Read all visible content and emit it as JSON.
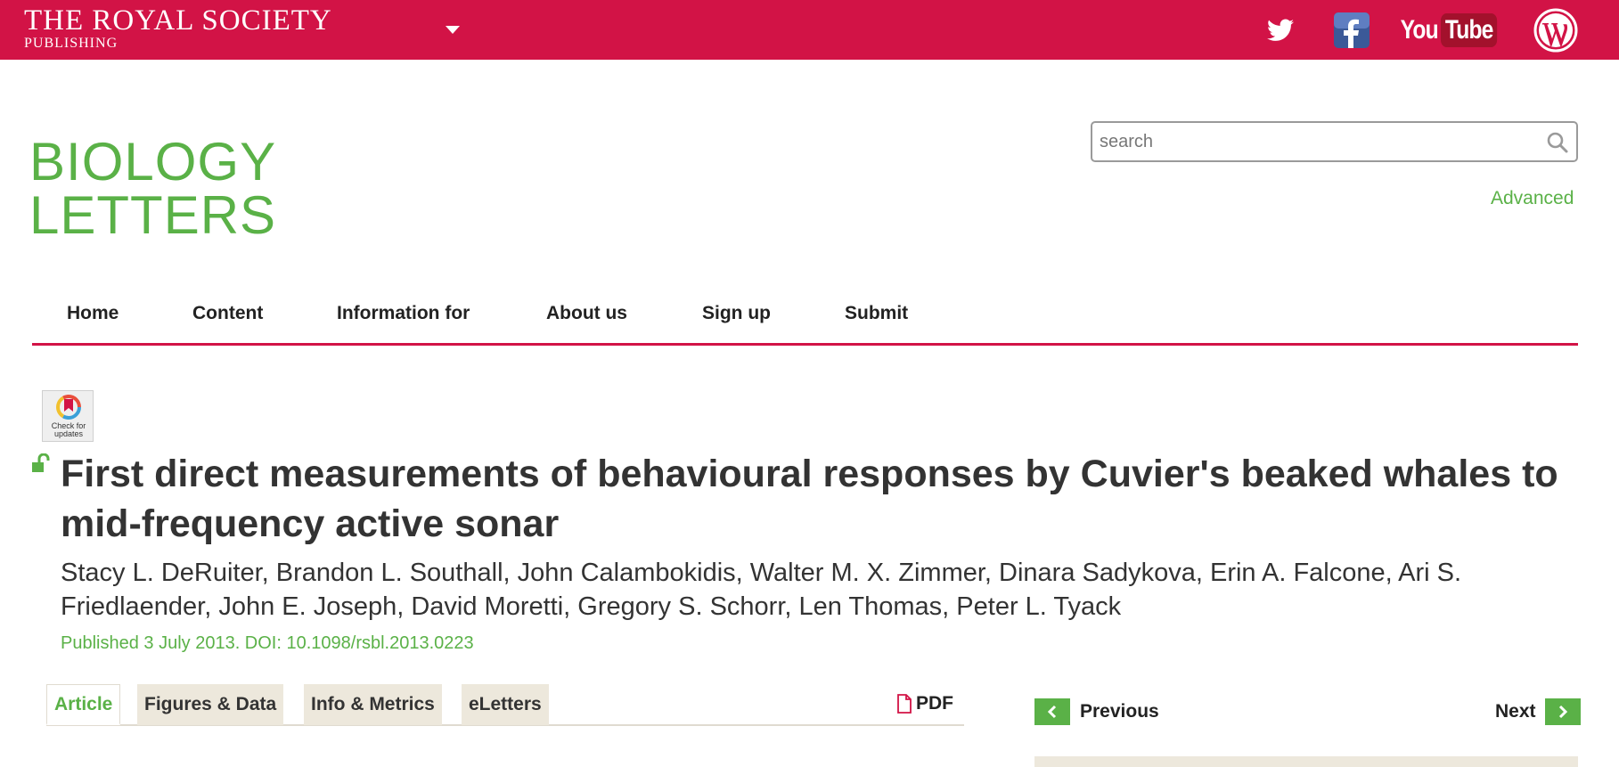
{
  "brand": {
    "name": "THE ROYAL SOCIETY",
    "sub": "PUBLISHING"
  },
  "social": {
    "youtube_you": "You",
    "youtube_tube": "Tube"
  },
  "journal": {
    "line1": "BIOLOGY",
    "line2": "LETTERS"
  },
  "search": {
    "placeholder": "search",
    "advanced_label": "Advanced"
  },
  "nav": {
    "items": [
      "Home",
      "Content",
      "Information for",
      "About us",
      "Sign up",
      "Submit"
    ]
  },
  "crossmark": {
    "label_line1": "Check for",
    "label_line2": "updates"
  },
  "article": {
    "title": "First direct measurements of behavioural responses by Cuvier's beaked whales to mid-frequency active sonar",
    "authors": "Stacy L. DeRuiter, Brandon L. Southall, John Calambokidis, Walter M. X. Zimmer, Dinara Sadykova, Erin A. Falcone, Ari S. Friedlaender, John E. Joseph, David Moretti, Gregory S. Schorr, Len Thomas, Peter L. Tyack",
    "published": "Published 3 July 2013. DOI: 10.1098/rsbl.2013.0223"
  },
  "tabs": {
    "items": [
      "Article",
      "Figures & Data",
      "Info & Metrics",
      "eLetters"
    ],
    "active": "Article",
    "pdf_label": "PDF"
  },
  "pager": {
    "previous_label": "Previous",
    "next_label": "Next"
  },
  "colors": {
    "brand_red": "#d21346",
    "accent_green": "#5ab147",
    "tab_beige": "#ede8dc"
  }
}
